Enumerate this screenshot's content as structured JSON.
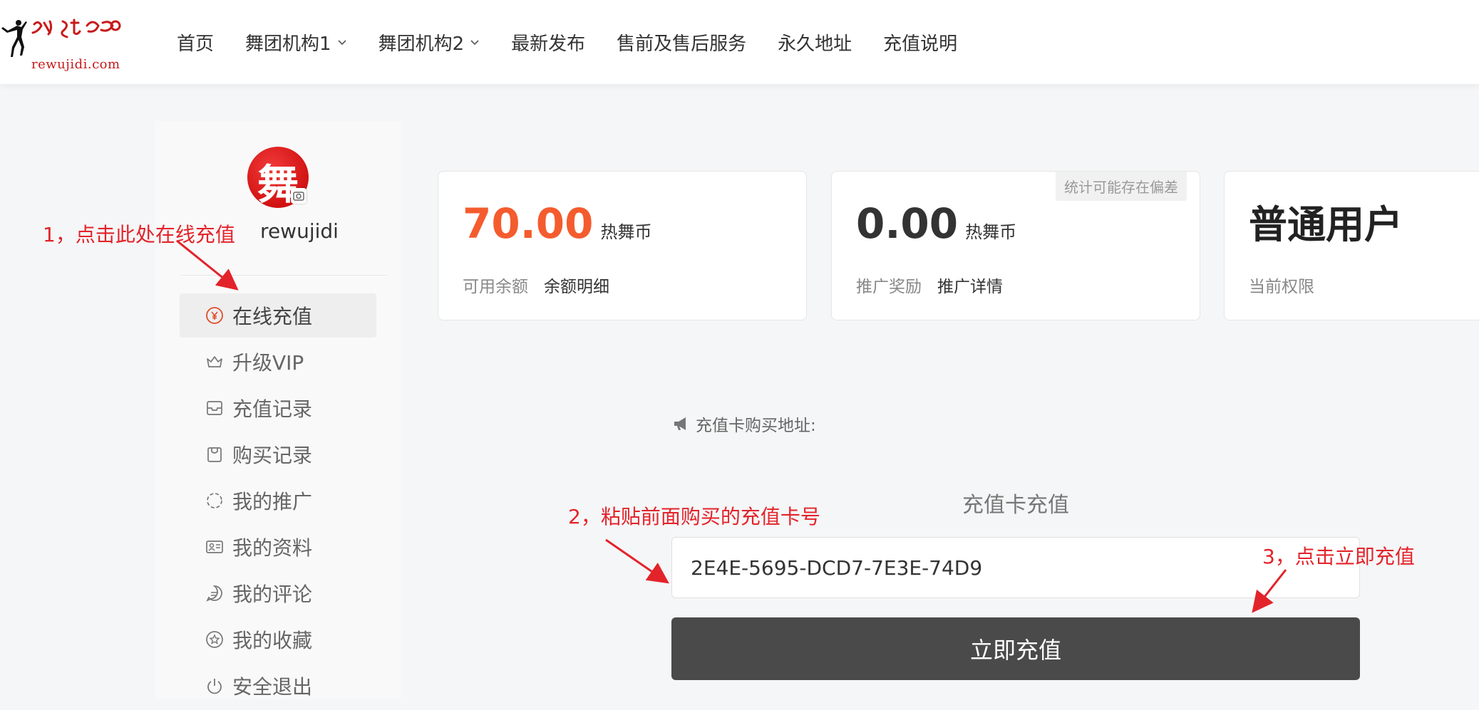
{
  "header": {
    "logo_text": "rewujidi.com",
    "nav": [
      {
        "label": "首页"
      },
      {
        "label": "舞团机构1"
      },
      {
        "label": "舞团机构2"
      },
      {
        "label": "最新发布"
      },
      {
        "label": "售前及售后服务"
      },
      {
        "label": "永久地址"
      },
      {
        "label": "充值说明"
      }
    ]
  },
  "sidebar": {
    "avatar_char": "舞",
    "username": "rewujidi",
    "menu": [
      {
        "label": "在线充值",
        "icon": "yen-circle-icon"
      },
      {
        "label": "升级VIP",
        "icon": "crown-icon"
      },
      {
        "label": "充值记录",
        "icon": "inbox-icon"
      },
      {
        "label": "购买记录",
        "icon": "shopping-bag-icon"
      },
      {
        "label": "我的推广",
        "icon": "loading-circle-icon"
      },
      {
        "label": "我的资料",
        "icon": "id-card-icon"
      },
      {
        "label": "我的评论",
        "icon": "comment-icon"
      },
      {
        "label": "我的收藏",
        "icon": "star-circle-icon"
      },
      {
        "label": "安全退出",
        "icon": "power-icon"
      }
    ]
  },
  "stats": {
    "balance": {
      "value": "70.00",
      "unit": "热舞币",
      "label": "可用余额",
      "link": "余额明细"
    },
    "promotion": {
      "value": "0.00",
      "unit": "热舞币",
      "label": "推广奖励",
      "link": "推广详情",
      "tag": "统计可能存在偏差"
    },
    "role": {
      "value": "普通用户",
      "label": "当前权限"
    }
  },
  "recharge": {
    "buy_address_label": "充值卡购买地址:",
    "title": "充值卡充值",
    "card_number": "2E4E-5695-DCD7-7E3E-74D9",
    "submit_label": "立即充值"
  },
  "annotations": {
    "step1": "1，点击此处在线充值",
    "step2": "2，粘贴前面购买的充值卡号",
    "step3": "3，点击立即充值"
  },
  "colors": {
    "accent_orange": "#f45c2e",
    "annotation_red": "#e3232a",
    "button_dark": "#4a4a4a"
  }
}
